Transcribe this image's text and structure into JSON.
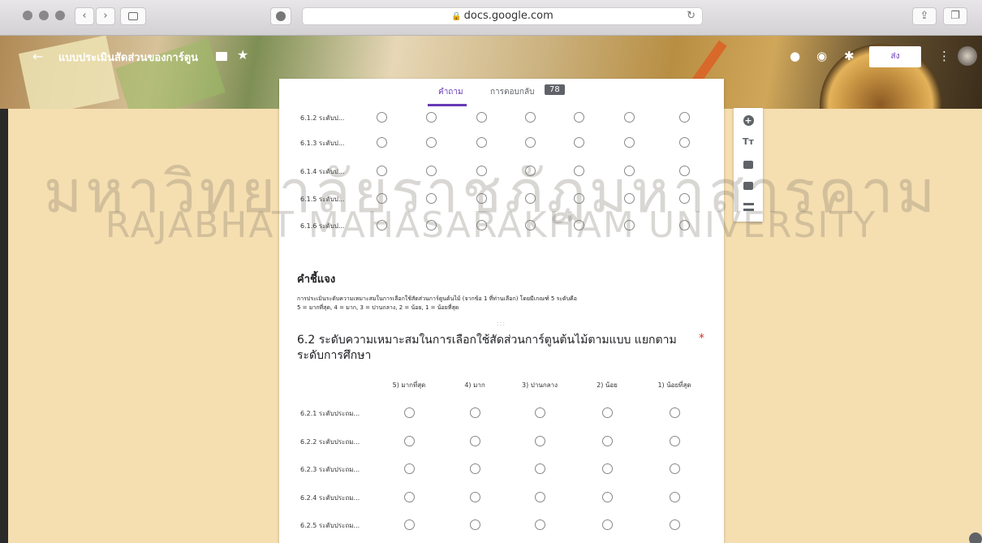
{
  "browser": {
    "url": "docs.google.com",
    "back_label": "‹",
    "forward_label": "›"
  },
  "header": {
    "back_icon": "←",
    "title": "แบบประเมินสัดส่วนของการ์ตูน",
    "star_icon": "★",
    "send_label": "ส่ง",
    "more_icon": "⋮"
  },
  "watermark": {
    "line1": "มหาวิทยาลัยราชภัฏมหาสารคาม",
    "line2": "RAJABHAT MAHASARAKHAM UNIVERSITY"
  },
  "tabs": {
    "questions": "คำถาม",
    "responses": "การตอบกลับ",
    "responses_count": "78"
  },
  "grid1": {
    "rows": [
      "6.1.2 ระดับป...",
      "6.1.3 ระดับป...",
      "6.1.4 ระดับป...",
      "6.1.5 ระดับป...",
      "6.1.6 ระดับป..."
    ],
    "options_per_row": 7
  },
  "section": {
    "title": "คำชี้แจง",
    "description_line1": "การประเมินระดับความเหมาะสมในการเลือกใช้สัดส่วนการ์ตูนต้นไม้ (จากข้อ 1 ที่ท่านเลือก) โดยมีเกณฑ์ 5 ระดับคือ",
    "description_line2": "5 = มากที่สุด, 4 = มาก, 3 = ปานกลาง, 2 = น้อย, 1 = น้อยที่สุด",
    "drag_handle": ":::"
  },
  "question": {
    "title": "6.2 ระดับความเหมาะสมในการเลือกใช้สัดส่วนการ์ตูนต้นไม้ตามแบบ แยกตามระดับการศึกษา",
    "required_mark": "*",
    "columns": [
      "5) มากที่สุด",
      "4) มาก",
      "3) ปานกลาง",
      "2) น้อย",
      "1) น้อยที่สุด"
    ],
    "rows": [
      "6.2.1 ระดับประถม...",
      "6.2.2 ระดับประถม...",
      "6.2.3 ระดับประถม...",
      "6.2.4 ระดับประถม...",
      "6.2.5 ระดับประถม..."
    ]
  },
  "side_toolbar": {
    "add_icon": "+",
    "title_icon": "Tт"
  }
}
